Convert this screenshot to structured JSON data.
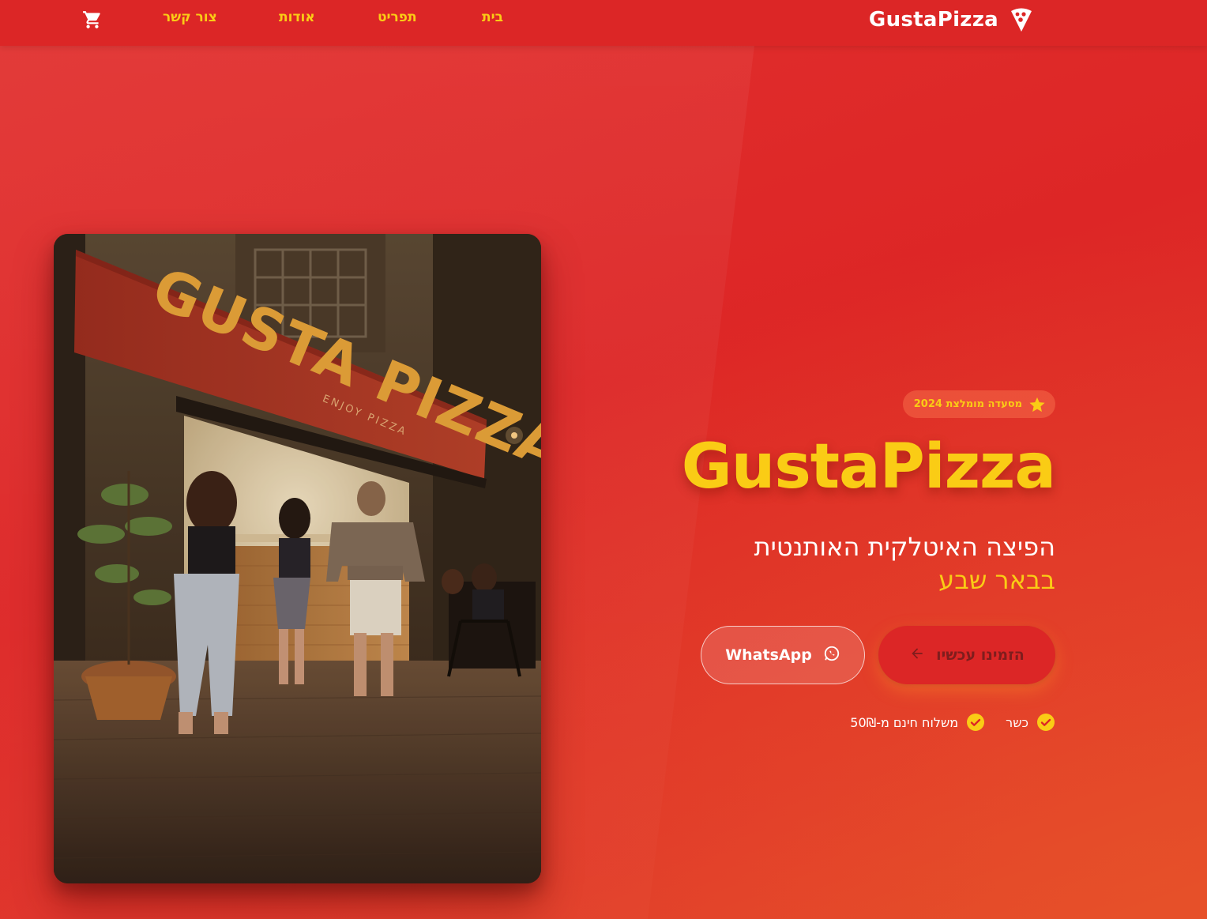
{
  "nav": {
    "brand": "GustaPizza",
    "links": [
      {
        "id": "home",
        "label": "בית"
      },
      {
        "id": "menu",
        "label": "תפריט"
      },
      {
        "id": "about",
        "label": "אודות"
      },
      {
        "id": "contact",
        "label": "צור קשר"
      }
    ],
    "cart_icon": "cart-icon",
    "brand_icon": "pizza-slice-icon"
  },
  "hero": {
    "badge": "מסעדה מומלצת 2024",
    "badge_icon": "star-icon",
    "title": "GustaPizza",
    "subtitle": "הפיצה האיטלקית האותנטית",
    "city": "בבאר שבע",
    "order_button": "הזמינו עכשיו",
    "order_icon": "arrow-left-icon",
    "whatsapp_button": "WhatsApp",
    "whatsapp_icon": "whatsapp-icon",
    "features": [
      {
        "label": "כשר"
      },
      {
        "label": "משלוח חינם מ-50₪"
      }
    ]
  },
  "photo": {
    "sign_text": "GUSTA PIZZA",
    "sign_subtext": "ENJOY PIZZA"
  },
  "colors": {
    "primary_red": "#dc2626",
    "accent_yellow": "#facc15",
    "dark_red_text": "#7f1d1d",
    "white": "#ffffff"
  }
}
